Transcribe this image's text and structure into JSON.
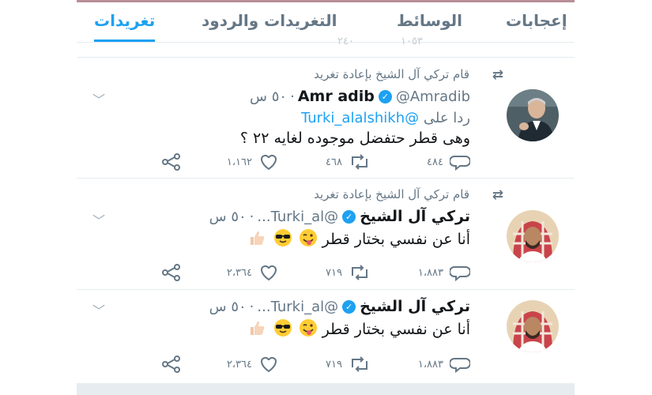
{
  "tabs": [
    {
      "label": "تغريدات",
      "active": true
    },
    {
      "label": "التغريدات والردود",
      "active": false
    },
    {
      "label": "الوسائط",
      "active": false
    },
    {
      "label": "إعجابات",
      "active": false
    }
  ],
  "ghost_counts": {
    "retweets": "٢٤٠",
    "likes": "١٠٥٣"
  },
  "tweets": [
    {
      "retweeted_by": "قام تركي آل الشيخ بإعادة تغريد",
      "name": "Amr adib",
      "handle": "@Amradib",
      "time": "٥٠ س",
      "reply_prefix": "ردا على",
      "reply_to": "@Turki_alalshikh",
      "text": "وهى قطر حتفضل موجوده لغايه ٢٢ ؟",
      "replies": "٤٨٤",
      "retweets": "٤٦٨",
      "likes": "١،١٦٢"
    },
    {
      "retweeted_by": "قام تركي آل الشيخ بإعادة تغريد",
      "name": "تركي آل الشيخ",
      "handle": "@Turki_al...",
      "time": "٥٠ س",
      "text": "أنا عن نفسي بختار قطر",
      "emojis": [
        "winking-tongue-emoji",
        "sunglasses-emoji",
        "thumbs-up-emoji"
      ],
      "replies": "١،٨٨٣",
      "retweets": "٧١٩",
      "likes": "٢،٣٦٤"
    },
    {
      "name": "تركي آل الشيخ",
      "handle": "@Turki_al...",
      "time": "٥٠ س",
      "text": "أنا عن نفسي بختار قطر",
      "emojis": [
        "winking-tongue-emoji",
        "sunglasses-emoji",
        "thumbs-up-emoji"
      ],
      "replies": "١،٨٨٣",
      "retweets": "٧١٩",
      "likes": "٢،٣٦٤"
    }
  ],
  "colors": {
    "accent": "#1da1f2",
    "muted": "#657786",
    "text": "#14171a",
    "separator": "#e6ecf0"
  }
}
